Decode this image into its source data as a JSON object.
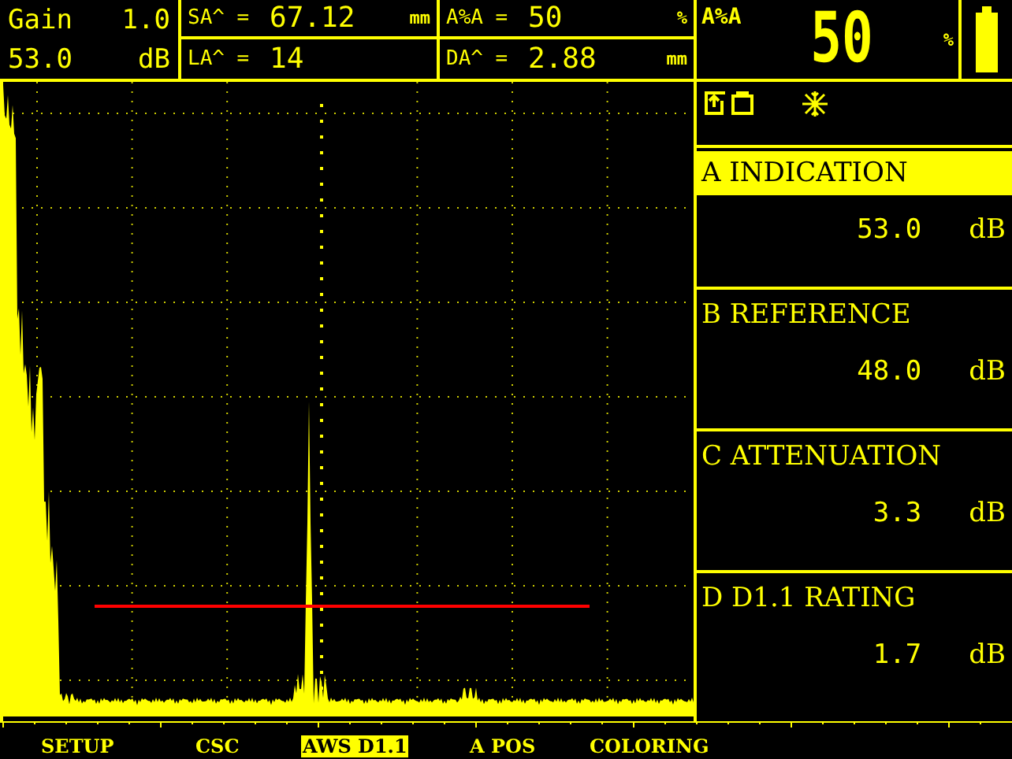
{
  "header": {
    "gain_label": "Gain",
    "gain_step": "1.0",
    "gain_value": "53.0",
    "gain_unit": "dB",
    "readings": [
      {
        "label": "SA^ =",
        "value": "67.12",
        "unit": "mm"
      },
      {
        "label": "A%A =",
        "value": "50",
        "unit": "%"
      },
      {
        "label": "LA^ =",
        "value": "14"
      },
      {
        "label": "DA^ =",
        "value": "2.88",
        "unit": "mm"
      }
    ],
    "big_label": "A%A",
    "big_value": "50",
    "big_unit": "%"
  },
  "menu": [
    {
      "letter": "A",
      "label": "INDICATION",
      "value": "53.0",
      "unit": "dB",
      "selected": true
    },
    {
      "letter": "B",
      "label": "REFERENCE",
      "value": "48.0",
      "unit": "dB",
      "selected": false
    },
    {
      "letter": "C",
      "label": "ATTENUATION",
      "value": "3.3",
      "unit": "dB",
      "selected": false
    },
    {
      "letter": "D",
      "label": "D1.1 RATING",
      "value": "1.7",
      "unit": "dB",
      "selected": false
    }
  ],
  "softkeys": [
    {
      "label": "SETUP",
      "selected": false
    },
    {
      "label": "CSC",
      "selected": false
    },
    {
      "label": "AWS D1.1",
      "selected": true
    },
    {
      "label": "A POS",
      "selected": false
    },
    {
      "label": "COLORING",
      "selected": false
    }
  ]
}
